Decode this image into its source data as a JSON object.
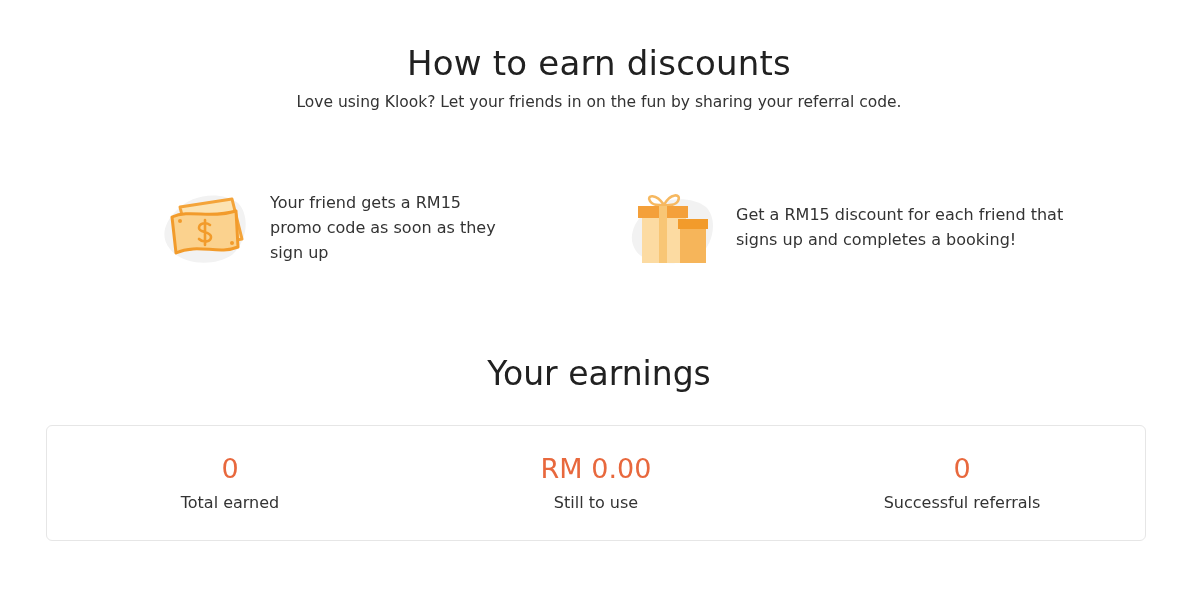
{
  "intro": {
    "title": "How to earn discounts",
    "subtitle": "Love using Klook? Let your friends in on the fun by sharing your referral code."
  },
  "steps": [
    {
      "kind": "cash",
      "text": "Your friend gets a RM15 promo code as soon as they sign up"
    },
    {
      "kind": "gift",
      "text": "Get a RM15 discount for each friend that signs up and completes a booking!"
    }
  ],
  "earnings": {
    "title": "Your earnings",
    "stats": [
      {
        "value": "0",
        "label": "Total earned"
      },
      {
        "value": "RM 0.00",
        "label": "Still to use"
      },
      {
        "value": "0",
        "label": "Successful referrals"
      }
    ]
  }
}
